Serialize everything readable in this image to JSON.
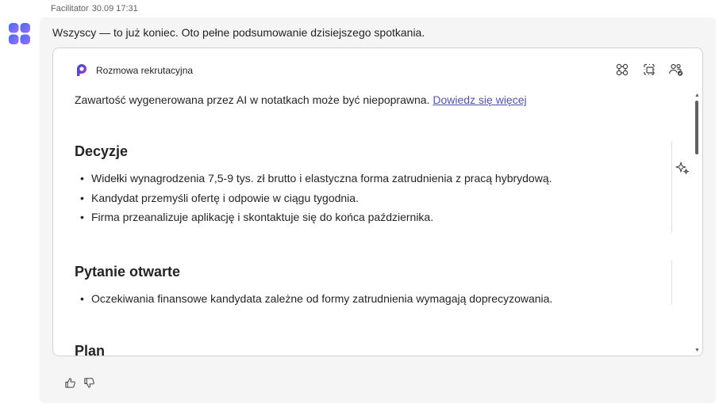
{
  "message": {
    "sender": "Facilitator",
    "timestamp": "30.09 17:31",
    "text": "Wszyscy — to już koniec. Oto pełne podsumowanie dzisiejszego spotkania."
  },
  "card": {
    "title": "Rozmowa rekrutacyjna",
    "disclaimer": "Zawartość wygenerowana przez AI w notatkach może być niepoprawna.",
    "learn_more": "Dowiedz się więcej",
    "sections": [
      {
        "heading": "Decyzje",
        "items": [
          "Widełki wynagrodzenia 7,5-9 tys. zł brutto i elastyczna forma zatrudnienia z pracą hybrydową.",
          "Kandydat przemyśli ofertę i odpowie w ciągu tygodnia.",
          "Firma przeanalizuje aplikację i skontaktuje się do końca października."
        ]
      },
      {
        "heading": "Pytanie otwarte",
        "items": [
          "Oczekiwania finansowe kandydata zależne od formy zatrudnienia wymagają doprecyzowania."
        ]
      },
      {
        "heading": "Plan",
        "items": []
      }
    ]
  },
  "icons": {
    "avatar": "copilot-sparkle-icon",
    "header_actions": [
      "loop-components-icon",
      "copy-frame-icon",
      "people-check-icon"
    ],
    "section_action": "sparkle-icon",
    "reactions": [
      "thumbs-up-icon",
      "thumbs-down-icon"
    ]
  },
  "colors": {
    "link": "#4f52b2",
    "bubble_bg": "#f5f5f5",
    "card_border": "#d1d1d1",
    "avatar_gradient_start": "#3b6cf6",
    "avatar_gradient_end": "#a86bf5"
  }
}
